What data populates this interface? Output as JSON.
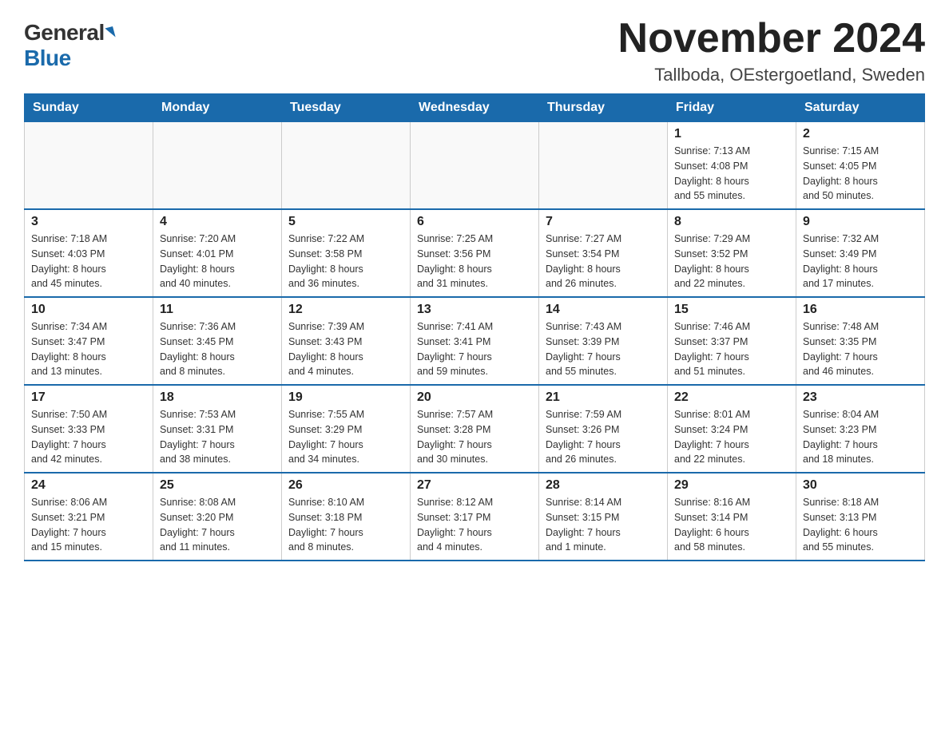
{
  "header": {
    "logo_general": "General",
    "logo_blue": "Blue",
    "title": "November 2024",
    "subtitle": "Tallboda, OEstergoetland, Sweden"
  },
  "calendar": {
    "weekdays": [
      "Sunday",
      "Monday",
      "Tuesday",
      "Wednesday",
      "Thursday",
      "Friday",
      "Saturday"
    ],
    "weeks": [
      [
        {
          "day": "",
          "info": ""
        },
        {
          "day": "",
          "info": ""
        },
        {
          "day": "",
          "info": ""
        },
        {
          "day": "",
          "info": ""
        },
        {
          "day": "",
          "info": ""
        },
        {
          "day": "1",
          "info": "Sunrise: 7:13 AM\nSunset: 4:08 PM\nDaylight: 8 hours\nand 55 minutes."
        },
        {
          "day": "2",
          "info": "Sunrise: 7:15 AM\nSunset: 4:05 PM\nDaylight: 8 hours\nand 50 minutes."
        }
      ],
      [
        {
          "day": "3",
          "info": "Sunrise: 7:18 AM\nSunset: 4:03 PM\nDaylight: 8 hours\nand 45 minutes."
        },
        {
          "day": "4",
          "info": "Sunrise: 7:20 AM\nSunset: 4:01 PM\nDaylight: 8 hours\nand 40 minutes."
        },
        {
          "day": "5",
          "info": "Sunrise: 7:22 AM\nSunset: 3:58 PM\nDaylight: 8 hours\nand 36 minutes."
        },
        {
          "day": "6",
          "info": "Sunrise: 7:25 AM\nSunset: 3:56 PM\nDaylight: 8 hours\nand 31 minutes."
        },
        {
          "day": "7",
          "info": "Sunrise: 7:27 AM\nSunset: 3:54 PM\nDaylight: 8 hours\nand 26 minutes."
        },
        {
          "day": "8",
          "info": "Sunrise: 7:29 AM\nSunset: 3:52 PM\nDaylight: 8 hours\nand 22 minutes."
        },
        {
          "day": "9",
          "info": "Sunrise: 7:32 AM\nSunset: 3:49 PM\nDaylight: 8 hours\nand 17 minutes."
        }
      ],
      [
        {
          "day": "10",
          "info": "Sunrise: 7:34 AM\nSunset: 3:47 PM\nDaylight: 8 hours\nand 13 minutes."
        },
        {
          "day": "11",
          "info": "Sunrise: 7:36 AM\nSunset: 3:45 PM\nDaylight: 8 hours\nand 8 minutes."
        },
        {
          "day": "12",
          "info": "Sunrise: 7:39 AM\nSunset: 3:43 PM\nDaylight: 8 hours\nand 4 minutes."
        },
        {
          "day": "13",
          "info": "Sunrise: 7:41 AM\nSunset: 3:41 PM\nDaylight: 7 hours\nand 59 minutes."
        },
        {
          "day": "14",
          "info": "Sunrise: 7:43 AM\nSunset: 3:39 PM\nDaylight: 7 hours\nand 55 minutes."
        },
        {
          "day": "15",
          "info": "Sunrise: 7:46 AM\nSunset: 3:37 PM\nDaylight: 7 hours\nand 51 minutes."
        },
        {
          "day": "16",
          "info": "Sunrise: 7:48 AM\nSunset: 3:35 PM\nDaylight: 7 hours\nand 46 minutes."
        }
      ],
      [
        {
          "day": "17",
          "info": "Sunrise: 7:50 AM\nSunset: 3:33 PM\nDaylight: 7 hours\nand 42 minutes."
        },
        {
          "day": "18",
          "info": "Sunrise: 7:53 AM\nSunset: 3:31 PM\nDaylight: 7 hours\nand 38 minutes."
        },
        {
          "day": "19",
          "info": "Sunrise: 7:55 AM\nSunset: 3:29 PM\nDaylight: 7 hours\nand 34 minutes."
        },
        {
          "day": "20",
          "info": "Sunrise: 7:57 AM\nSunset: 3:28 PM\nDaylight: 7 hours\nand 30 minutes."
        },
        {
          "day": "21",
          "info": "Sunrise: 7:59 AM\nSunset: 3:26 PM\nDaylight: 7 hours\nand 26 minutes."
        },
        {
          "day": "22",
          "info": "Sunrise: 8:01 AM\nSunset: 3:24 PM\nDaylight: 7 hours\nand 22 minutes."
        },
        {
          "day": "23",
          "info": "Sunrise: 8:04 AM\nSunset: 3:23 PM\nDaylight: 7 hours\nand 18 minutes."
        }
      ],
      [
        {
          "day": "24",
          "info": "Sunrise: 8:06 AM\nSunset: 3:21 PM\nDaylight: 7 hours\nand 15 minutes."
        },
        {
          "day": "25",
          "info": "Sunrise: 8:08 AM\nSunset: 3:20 PM\nDaylight: 7 hours\nand 11 minutes."
        },
        {
          "day": "26",
          "info": "Sunrise: 8:10 AM\nSunset: 3:18 PM\nDaylight: 7 hours\nand 8 minutes."
        },
        {
          "day": "27",
          "info": "Sunrise: 8:12 AM\nSunset: 3:17 PM\nDaylight: 7 hours\nand 4 minutes."
        },
        {
          "day": "28",
          "info": "Sunrise: 8:14 AM\nSunset: 3:15 PM\nDaylight: 7 hours\nand 1 minute."
        },
        {
          "day": "29",
          "info": "Sunrise: 8:16 AM\nSunset: 3:14 PM\nDaylight: 6 hours\nand 58 minutes."
        },
        {
          "day": "30",
          "info": "Sunrise: 8:18 AM\nSunset: 3:13 PM\nDaylight: 6 hours\nand 55 minutes."
        }
      ]
    ]
  }
}
